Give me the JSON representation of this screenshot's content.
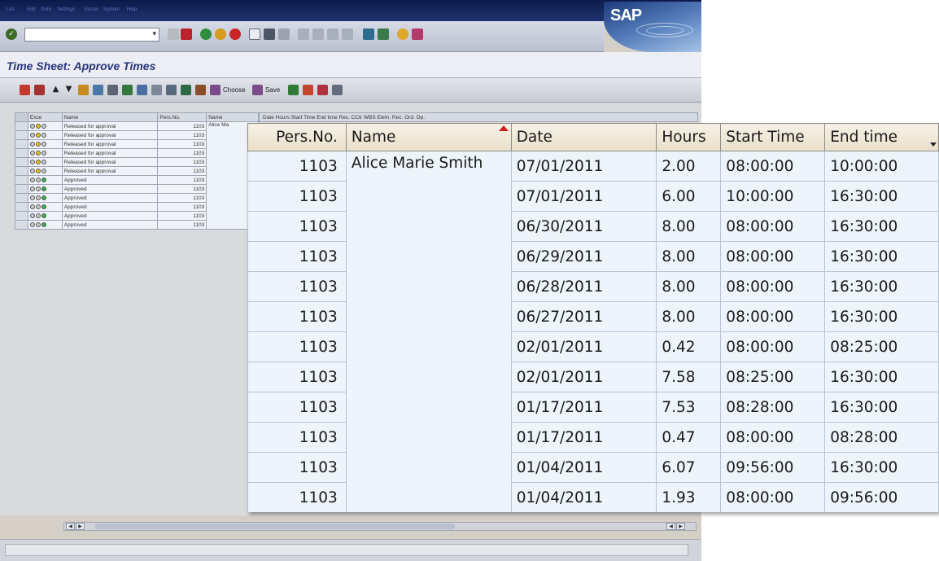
{
  "menu": [
    "List",
    "Edit",
    "Goto",
    "Settings",
    "Extras",
    "System",
    "Help"
  ],
  "brand": {
    "logo_text": "SAP",
    "accent": "#28357a"
  },
  "window": {
    "title": "Time Sheet: Approve Times"
  },
  "app_toolbar": {
    "choose_label": "Choose",
    "save_label": "Save"
  },
  "small_grid": {
    "headers": [
      "Exce",
      "Name",
      "Pers.No.",
      "Name"
    ],
    "headers_rest": "Date   Hours  Start Time  End time   Rec. CCtr   WBS Elem.  Rec. Ord.  Op.",
    "name_value": "Alice Ma",
    "rows": [
      {
        "status": "Released for approval",
        "pers": "1103",
        "light": "yellow"
      },
      {
        "status": "Released for approval",
        "pers": "1103",
        "light": "yellow"
      },
      {
        "status": "Released for approval",
        "pers": "1103",
        "light": "yellow"
      },
      {
        "status": "Released for approval",
        "pers": "1103",
        "light": "yellow"
      },
      {
        "status": "Released for approval",
        "pers": "1103",
        "light": "yellow"
      },
      {
        "status": "Released for approval",
        "pers": "1103",
        "light": "yellow"
      },
      {
        "status": "Approved",
        "pers": "1103",
        "light": "green"
      },
      {
        "status": "Approved",
        "pers": "1103",
        "light": "green"
      },
      {
        "status": "Approved",
        "pers": "1103",
        "light": "green"
      },
      {
        "status": "Approved",
        "pers": "1103",
        "light": "green"
      },
      {
        "status": "Approved",
        "pers": "1103",
        "light": "green"
      },
      {
        "status": "Approved",
        "pers": "1103",
        "light": "green"
      }
    ]
  },
  "zoom_table": {
    "headers": {
      "pers": "Pers.No.",
      "name": "Name",
      "date": "Date",
      "hours": "Hours",
      "start": "Start Time",
      "end": "End time"
    },
    "name_value": "Alice Marie Smith",
    "rows": [
      {
        "pers": "1103",
        "date": "07/01/2011",
        "hours": "2.00",
        "start": "08:00:00",
        "end": "10:00:00"
      },
      {
        "pers": "1103",
        "date": "07/01/2011",
        "hours": "6.00",
        "start": "10:00:00",
        "end": "16:30:00"
      },
      {
        "pers": "1103",
        "date": "06/30/2011",
        "hours": "8.00",
        "start": "08:00:00",
        "end": "16:30:00"
      },
      {
        "pers": "1103",
        "date": "06/29/2011",
        "hours": "8.00",
        "start": "08:00:00",
        "end": "16:30:00"
      },
      {
        "pers": "1103",
        "date": "06/28/2011",
        "hours": "8.00",
        "start": "08:00:00",
        "end": "16:30:00"
      },
      {
        "pers": "1103",
        "date": "06/27/2011",
        "hours": "8.00",
        "start": "08:00:00",
        "end": "16:30:00"
      },
      {
        "pers": "1103",
        "date": "02/01/2011",
        "hours": "0.42",
        "start": "08:00:00",
        "end": "08:25:00"
      },
      {
        "pers": "1103",
        "date": "02/01/2011",
        "hours": "7.58",
        "start": "08:25:00",
        "end": "16:30:00"
      },
      {
        "pers": "1103",
        "date": "01/17/2011",
        "hours": "7.53",
        "start": "08:28:00",
        "end": "16:30:00"
      },
      {
        "pers": "1103",
        "date": "01/17/2011",
        "hours": "0.47",
        "start": "08:00:00",
        "end": "08:28:00"
      },
      {
        "pers": "1103",
        "date": "01/04/2011",
        "hours": "6.07",
        "start": "09:56:00",
        "end": "16:30:00"
      },
      {
        "pers": "1103",
        "date": "01/04/2011",
        "hours": "1.93",
        "start": "08:00:00",
        "end": "09:56:00"
      }
    ]
  }
}
